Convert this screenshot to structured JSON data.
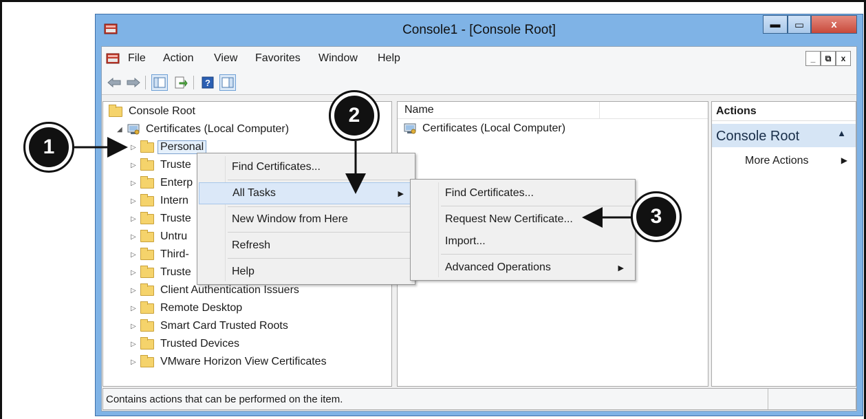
{
  "window": {
    "title": "Console1 - [Console Root]",
    "min_glyph": "▬",
    "max_glyph": "▭",
    "close_glyph": "x"
  },
  "menubar": {
    "items": [
      "File",
      "Action",
      "View",
      "Favorites",
      "Window",
      "Help"
    ],
    "mdi_min": "_",
    "mdi_restore": "⧉",
    "mdi_close": "x"
  },
  "toolbar": {
    "icons": [
      "back-icon",
      "forward-icon",
      "show-hide-tree-icon",
      "export-list-icon",
      "help-icon",
      "show-hide-action-pane-icon"
    ]
  },
  "tree": {
    "root": "Console Root",
    "certificates": "Certificates (Local Computer)",
    "items": [
      "Personal",
      "Truste",
      "Enterp",
      "Intern",
      "Truste",
      "Untru",
      "Third-",
      "Truste",
      "Client Authentication Issuers",
      "Remote Desktop",
      "Smart Card Trusted Roots",
      "Trusted Devices",
      "VMware Horizon View Certificates"
    ]
  },
  "list": {
    "column_name": "Name",
    "rows": [
      "Certificates (Local Computer)"
    ]
  },
  "actions": {
    "header": "Actions",
    "section": "Console Root",
    "more_actions": "More Actions"
  },
  "context_menu": {
    "items": [
      "Find Certificates...",
      "All Tasks",
      "New Window from Here",
      "Refresh",
      "Help"
    ]
  },
  "submenu": {
    "items": [
      "Find Certificates...",
      "Request New Certificate...",
      "Import...",
      "Advanced Operations"
    ]
  },
  "status": {
    "text": "Contains actions that can be performed on the item."
  },
  "callouts": [
    "1",
    "2",
    "3"
  ],
  "colors": {
    "titlebar": "#7fb3e6",
    "close_button": "#c8493a",
    "highlight": "#dbe8f8",
    "callout": "#111111"
  }
}
